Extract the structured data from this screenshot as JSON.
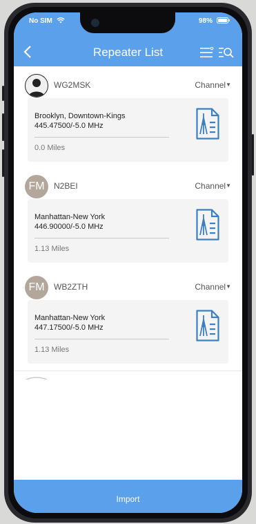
{
  "status_bar": {
    "carrier": "No SIM",
    "battery": "98%"
  },
  "header": {
    "title": "Repeater List"
  },
  "repeaters": [
    {
      "avatar": "user",
      "avatar_text": "",
      "callsign": "WG2MSK",
      "channel_label": "Channel",
      "location": "Brooklyn, Downtown-Kings",
      "frequency": "445.47500/-5.0 MHz",
      "distance": "0.0 Miles"
    },
    {
      "avatar": "fm",
      "avatar_text": "FM",
      "callsign": "N2BEI",
      "channel_label": "Channel",
      "location": "Manhattan-New York",
      "frequency": "446.90000/-5.0 MHz",
      "distance": "1.13 Miles"
    },
    {
      "avatar": "fm",
      "avatar_text": "FM",
      "callsign": "WB2ZTH",
      "channel_label": "Channel",
      "location": "Manhattan-New York",
      "frequency": "447.17500/-5.0 MHz",
      "distance": "1.13 Miles"
    }
  ],
  "footer": {
    "import_label": "Import"
  },
  "colors": {
    "accent": "#5aa0ea",
    "card_bg": "#f4f4f4",
    "avatar_fm": "#b3a79c"
  }
}
